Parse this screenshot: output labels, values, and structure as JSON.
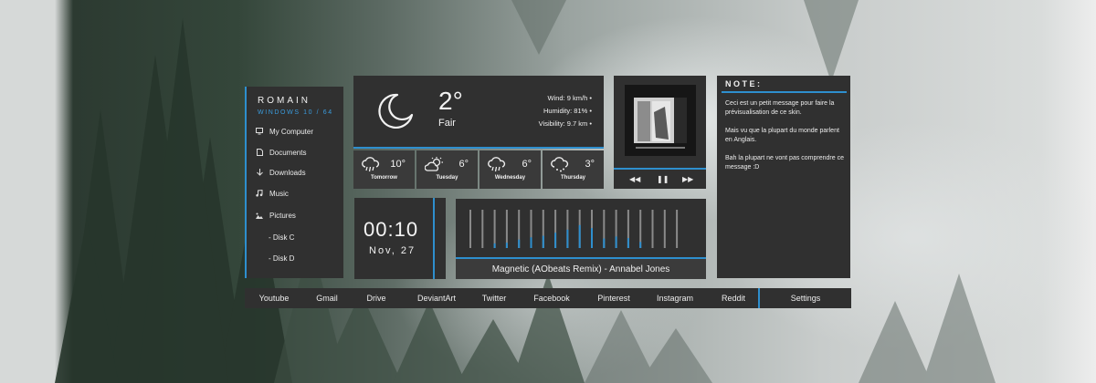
{
  "sidebar": {
    "username": "ROMAIN",
    "os": "WINDOWS 10 / 64",
    "items": [
      {
        "label": "My Computer",
        "icon": "monitor-icon"
      },
      {
        "label": "Documents",
        "icon": "document-icon"
      },
      {
        "label": "Downloads",
        "icon": "arrow-down-icon"
      },
      {
        "label": "Music",
        "icon": "music-note-icon"
      },
      {
        "label": "Pictures",
        "icon": "image-icon"
      }
    ],
    "disks": [
      "- Disk C",
      "- Disk D"
    ]
  },
  "weather": {
    "icon": "moon-icon",
    "temperature": "2°",
    "condition": "Fair",
    "wind": "Wind: 9 km/h •",
    "humidity": "Humidity: 81% •",
    "visibility": "Visibility: 9.7 km •",
    "forecast": [
      {
        "day": "Tomorrow",
        "temp": "10°",
        "icon": "rain-cloud-icon"
      },
      {
        "day": "Tuesday",
        "temp": "6°",
        "icon": "partly-sunny-icon"
      },
      {
        "day": "Wednesday",
        "temp": "6°",
        "icon": "rain-cloud-icon"
      },
      {
        "day": "Thursday",
        "temp": "3°",
        "icon": "snow-cloud-icon"
      }
    ]
  },
  "player": {
    "controls": {
      "prev": "◀◀",
      "pause": "❚❚",
      "next": "▶▶"
    },
    "song": "Magnetic (AObeats Remix) - Annabel Jones",
    "levels": [
      0,
      0,
      0.12,
      0.14,
      0.22,
      0.28,
      0.32,
      0.4,
      0.48,
      0.6,
      0.52,
      0.25,
      0.3,
      0.26,
      0.16,
      0,
      0,
      0
    ]
  },
  "clock": {
    "time": "00:10",
    "date": "Nov, 27"
  },
  "note": {
    "title": "NOTE:",
    "paragraphs": [
      "Ceci est un petit message pour faire la prévisualisation de ce skin.",
      "Mais vu que la plupart du monde parlent en Anglais.",
      "Bah la plupart ne vont pas comprendre ce message :D"
    ]
  },
  "nav": {
    "links": [
      "Youtube",
      "Gmail",
      "Drive",
      "DeviantArt",
      "Twitter",
      "Facebook",
      "Pinterest",
      "Instagram",
      "Reddit"
    ],
    "settings": "Settings"
  },
  "colors": {
    "accent": "#2e8fce",
    "panel": "#303030"
  }
}
